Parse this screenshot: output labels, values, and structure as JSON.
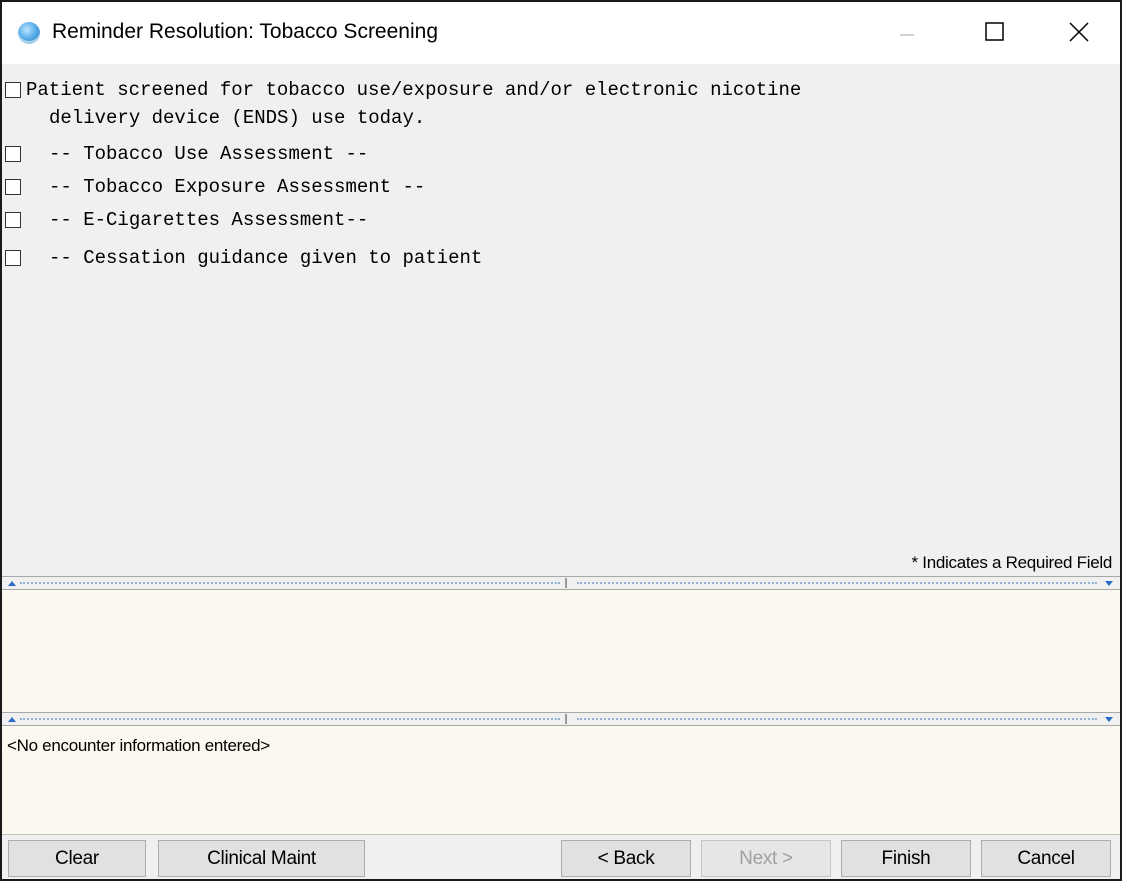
{
  "window": {
    "title": "Reminder Resolution: Tobacco Screening",
    "minimize_icon": "minimize-icon",
    "maximize_icon": "maximize-icon",
    "close_icon": "close-icon"
  },
  "checklist": [
    {
      "line1": "Patient screened for tobacco use/exposure and/or electronic nicotine",
      "line2": "delivery device (ENDS) use today.",
      "checked": false
    },
    {
      "label": "-- Tobacco Use Assessment --",
      "checked": false
    },
    {
      "label": "-- Tobacco Exposure Assessment --",
      "checked": false
    },
    {
      "label": "-- E-Cigarettes Assessment--",
      "checked": false
    },
    {
      "label": "-- Cessation guidance given to patient",
      "checked": false
    }
  ],
  "required_note": "* Indicates a Required Field",
  "progress_note_panel": {
    "text": ""
  },
  "encounter_panel": {
    "text": "<No encounter information entered>"
  },
  "buttons": {
    "clear": "Clear",
    "clinical_maint": "Clinical Maint",
    "back": "< Back",
    "next": "Next >",
    "finish": "Finish",
    "cancel": "Cancel"
  },
  "colors": {
    "panel_bg": "#fdf8ef",
    "window_bg": "#f0f0f0",
    "disabled_text": "#a0a0a0"
  }
}
